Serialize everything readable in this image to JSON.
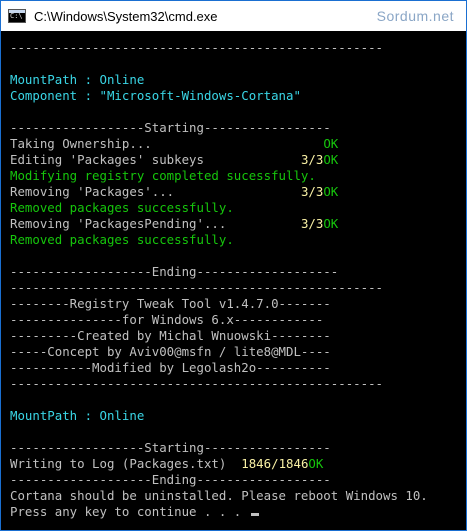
{
  "window": {
    "title": "C:\\Windows\\System32\\cmd.exe",
    "watermark": "Sordum.net",
    "colors": {
      "background": "#000000",
      "text": "#c0c0c0",
      "cyan": "#3ad6e6",
      "green": "#16c60c",
      "yellow": "#f9f1a5"
    }
  },
  "console": {
    "lines": [
      {
        "t": "--------------------------------------------------",
        "c": "gray"
      },
      {
        "t": "",
        "c": "gray"
      },
      {
        "t": "MountPath : Online",
        "c": "cyan"
      },
      {
        "t": "Component : \"Microsoft-Windows-Cortana\"",
        "c": "cyan"
      },
      {
        "t": "",
        "c": "gray"
      },
      {
        "t": "------------------Starting-----------------",
        "c": "gray"
      },
      {
        "segs": [
          {
            "t": "Taking Ownership...                       ",
            "c": "gray"
          },
          {
            "t": "OK",
            "c": "green"
          }
        ]
      },
      {
        "segs": [
          {
            "t": "Editing 'Packages' subkeys             ",
            "c": "gray"
          },
          {
            "t": "3/3",
            "c": "yellow"
          },
          {
            "t": "OK",
            "c": "green"
          }
        ]
      },
      {
        "t": "Modifying registry completed sucessfully.",
        "c": "green"
      },
      {
        "segs": [
          {
            "t": "Removing 'Packages'...                 ",
            "c": "gray"
          },
          {
            "t": "3/3",
            "c": "yellow"
          },
          {
            "t": "OK",
            "c": "green"
          }
        ]
      },
      {
        "t": "Removed packages successfully.",
        "c": "green"
      },
      {
        "segs": [
          {
            "t": "Removing 'PackagesPending'...          ",
            "c": "gray"
          },
          {
            "t": "3/3",
            "c": "yellow"
          },
          {
            "t": "OK",
            "c": "green"
          }
        ]
      },
      {
        "t": "Removed packages successfully.",
        "c": "green"
      },
      {
        "t": "",
        "c": "gray"
      },
      {
        "t": "-------------------Ending-------------------",
        "c": "gray"
      },
      {
        "t": "--------------------------------------------------",
        "c": "gray"
      },
      {
        "t": "--------Registry Tweak Tool v1.4.7.0-------",
        "c": "gray"
      },
      {
        "t": "---------------for Windows 6.x------------",
        "c": "gray"
      },
      {
        "t": "---------Created by Michal Wnuowski--------",
        "c": "gray"
      },
      {
        "t": "-----Concept by Aviv00@msfn / lite8@MDL----",
        "c": "gray"
      },
      {
        "t": "-----------Modified by Legolash2o----------",
        "c": "gray"
      },
      {
        "t": "--------------------------------------------------",
        "c": "gray"
      },
      {
        "t": "",
        "c": "gray"
      },
      {
        "t": "MountPath : Online",
        "c": "cyan"
      },
      {
        "t": "",
        "c": "gray"
      },
      {
        "t": "------------------Starting-----------------",
        "c": "gray"
      },
      {
        "segs": [
          {
            "t": "Writing to Log (Packages.txt)  ",
            "c": "gray"
          },
          {
            "t": "1846/1846",
            "c": "yellow"
          },
          {
            "t": "OK",
            "c": "green"
          }
        ]
      },
      {
        "t": "-------------------Ending------------------",
        "c": "gray"
      },
      {
        "t": "Cortana should be uninstalled. Please reboot Windows 10.",
        "c": "gray"
      },
      {
        "t": "Press any key to continue . . . ",
        "c": "gray",
        "cursor": true
      }
    ]
  }
}
